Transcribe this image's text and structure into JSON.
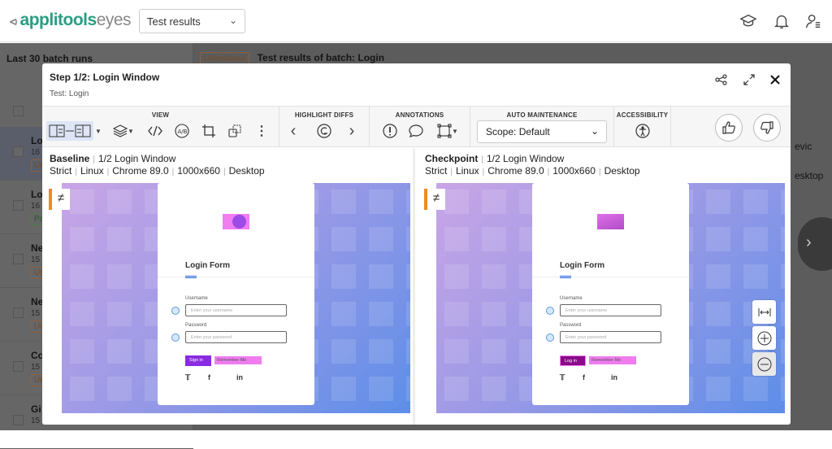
{
  "header": {
    "brand_main": "applitools",
    "brand_suffix": "eyes",
    "view_select": "Test results",
    "icons": [
      "graduation-cap-icon",
      "bell-icon",
      "user-settings-icon"
    ]
  },
  "background": {
    "sidebar_title": "Last 30 batch runs",
    "batch_status": "Unresolved",
    "batch_title": "Test results of batch:  Login",
    "partial_text_right": [
      "evic",
      "esktop"
    ],
    "items": [
      {
        "name": "Lo",
        "date": "16",
        "status": "Un"
      },
      {
        "name": "Lo",
        "date": "16",
        "status": "Pa"
      },
      {
        "name": "Ne",
        "date": "15",
        "status": "Un"
      },
      {
        "name": "Ne",
        "date": "15",
        "status": "Un"
      },
      {
        "name": "Co",
        "date": "15",
        "status": "Un"
      },
      {
        "name": "Gi",
        "date": "15",
        "status": ""
      }
    ]
  },
  "modal": {
    "title": "Step 1/2:  Login Window",
    "subtitle": "Test: Login",
    "toolbar": {
      "view": "VIEW",
      "highlight": "HIGHLIGHT DIFFS",
      "annotations": "ANNOTATIONS",
      "auto": "AUTO MAINTENANCE",
      "accessibility": "ACCESSIBILITY",
      "scope": "Scope: Default"
    },
    "baseline": {
      "label": "Baseline",
      "step": "1/2 Login Window",
      "match": "Strict",
      "os": "Linux",
      "browser": "Chrome 89.0",
      "size": "1000x660",
      "device": "Desktop"
    },
    "checkpoint": {
      "label": "Checkpoint",
      "step": "1/2 Login Window",
      "match": "Strict",
      "os": "Linux",
      "browser": "Chrome 89.0",
      "size": "1000x660",
      "device": "Desktop"
    },
    "form": {
      "title": "Login Form",
      "username_label": "Username",
      "username_ph": "Enter your username",
      "password_label": "Password",
      "password_ph": "Enter your password",
      "baseline_button": "Sign in",
      "checkpoint_button": "Log in",
      "remember": "Remember Me"
    },
    "colors": {
      "diff": "#f07cf0",
      "unresolved": "#f08a1e",
      "brand": "#2a9d82"
    }
  }
}
